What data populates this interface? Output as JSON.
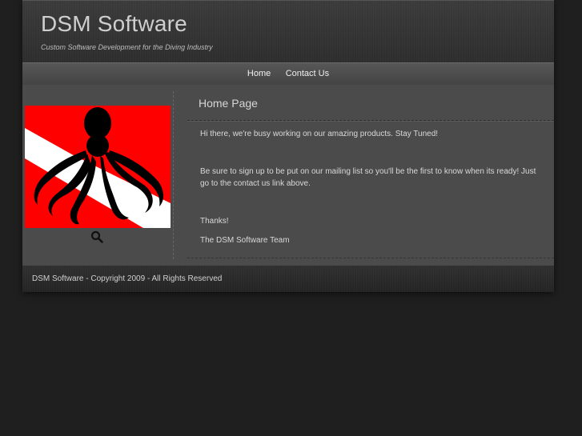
{
  "site": {
    "title": "DSM Software",
    "tagline": "Custom Software Development for the Diving Industry"
  },
  "nav": {
    "items": [
      {
        "label": "Home"
      },
      {
        "label": "Contact Us"
      }
    ]
  },
  "sidebar": {
    "logo": "octopus-dive-flag-logo",
    "zoom_icon": "search-icon"
  },
  "content": {
    "title": "Home Page",
    "paragraphs": [
      "Hi there, we're busy working on our amazing products.  Stay Tuned!",
      "Be sure to sign up to be put on our mailing list so you'll be the first to know when its ready!  Just go to the contact us link above.",
      "Thanks!",
      "The DSM Software Team"
    ]
  },
  "footer": {
    "text": "DSM Software - Copyright 2009 - All Rights Reserved"
  },
  "colors": {
    "background": "#1f1f1f",
    "panel": "#4b4b4b",
    "dive_flag_red": "#ff0000"
  }
}
